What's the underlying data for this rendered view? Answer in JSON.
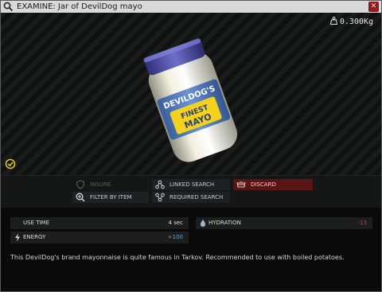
{
  "window": {
    "title": "EXAMINE: Jar of DevilDog mayo",
    "close_glyph": "✕"
  },
  "viewer": {
    "weight": "0.300Kg",
    "item_label": {
      "line1": "DEVILDOG'S",
      "line2": "FINEST",
      "line3": "MAYO"
    }
  },
  "actions": {
    "insure": "INSURE",
    "linked_search": "LINKED SEARCH",
    "discard": "DISCARD",
    "filter_by_item": "FILTER BY ITEM",
    "required_search": "REQUIRED SEARCH"
  },
  "stats": {
    "use_time": {
      "label": "USE TIME",
      "value": "4 sec"
    },
    "hydration": {
      "label": "HYDRATION",
      "value": "-13"
    },
    "energy": {
      "label": "ENERGY",
      "value": "+100"
    }
  },
  "description": "This DevilDog's brand mayonnaise is quite famous in Tarkov. Recommended to use with boiled potatoes.",
  "colors": {
    "positive": "#5fa0d6",
    "negative": "#c23b3b",
    "accent_yellow": "#d9c126",
    "discard_bg": "#5b1414"
  },
  "icons": {
    "title": "search-icon",
    "weight": "weight-icon",
    "examined": "check-circle-icon",
    "insure": "shield-icon",
    "linked_search": "linked-nodes-icon",
    "discard": "discard-hand-icon",
    "filter_by_item": "magnifier-plus-icon",
    "required_search": "required-nodes-icon",
    "energy": "lightning-icon",
    "hydration": "droplet-icon"
  }
}
